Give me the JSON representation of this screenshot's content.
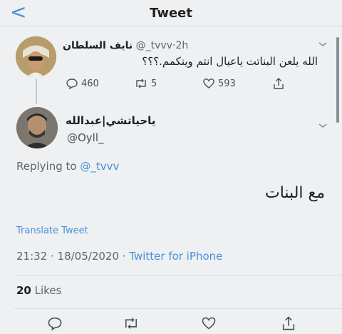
{
  "nav": {
    "back": "<",
    "title": "Tweet"
  },
  "tweet1": {
    "name": "نايف السلطان",
    "handle": "@_tvvv",
    "time": "2h",
    "text": "الله يلعن البناتت ياعيال انتم وينكمم.؟؟؟",
    "replies": "460",
    "retweets": "5",
    "likes": "593"
  },
  "tweet2": {
    "name": "ياحياتشي|عبدالله",
    "handle": "@Oyll_",
    "replying_prefix": "Replying to ",
    "replying_to": "@_tvvv",
    "text": "مع البنات",
    "translate": "Translate Tweet",
    "timestamp": "21:32 · 18/05/2020 · ",
    "client": "Twitter for iPhone",
    "likes_count": "20",
    "likes_label": "Likes"
  },
  "icons": [
    "chevron-left-icon",
    "chevron-down-icon",
    "reply-icon",
    "retweet-icon",
    "heart-icon",
    "share-icon"
  ],
  "colors": {
    "accent": "#4a90d9",
    "background": "#eef0f2"
  }
}
